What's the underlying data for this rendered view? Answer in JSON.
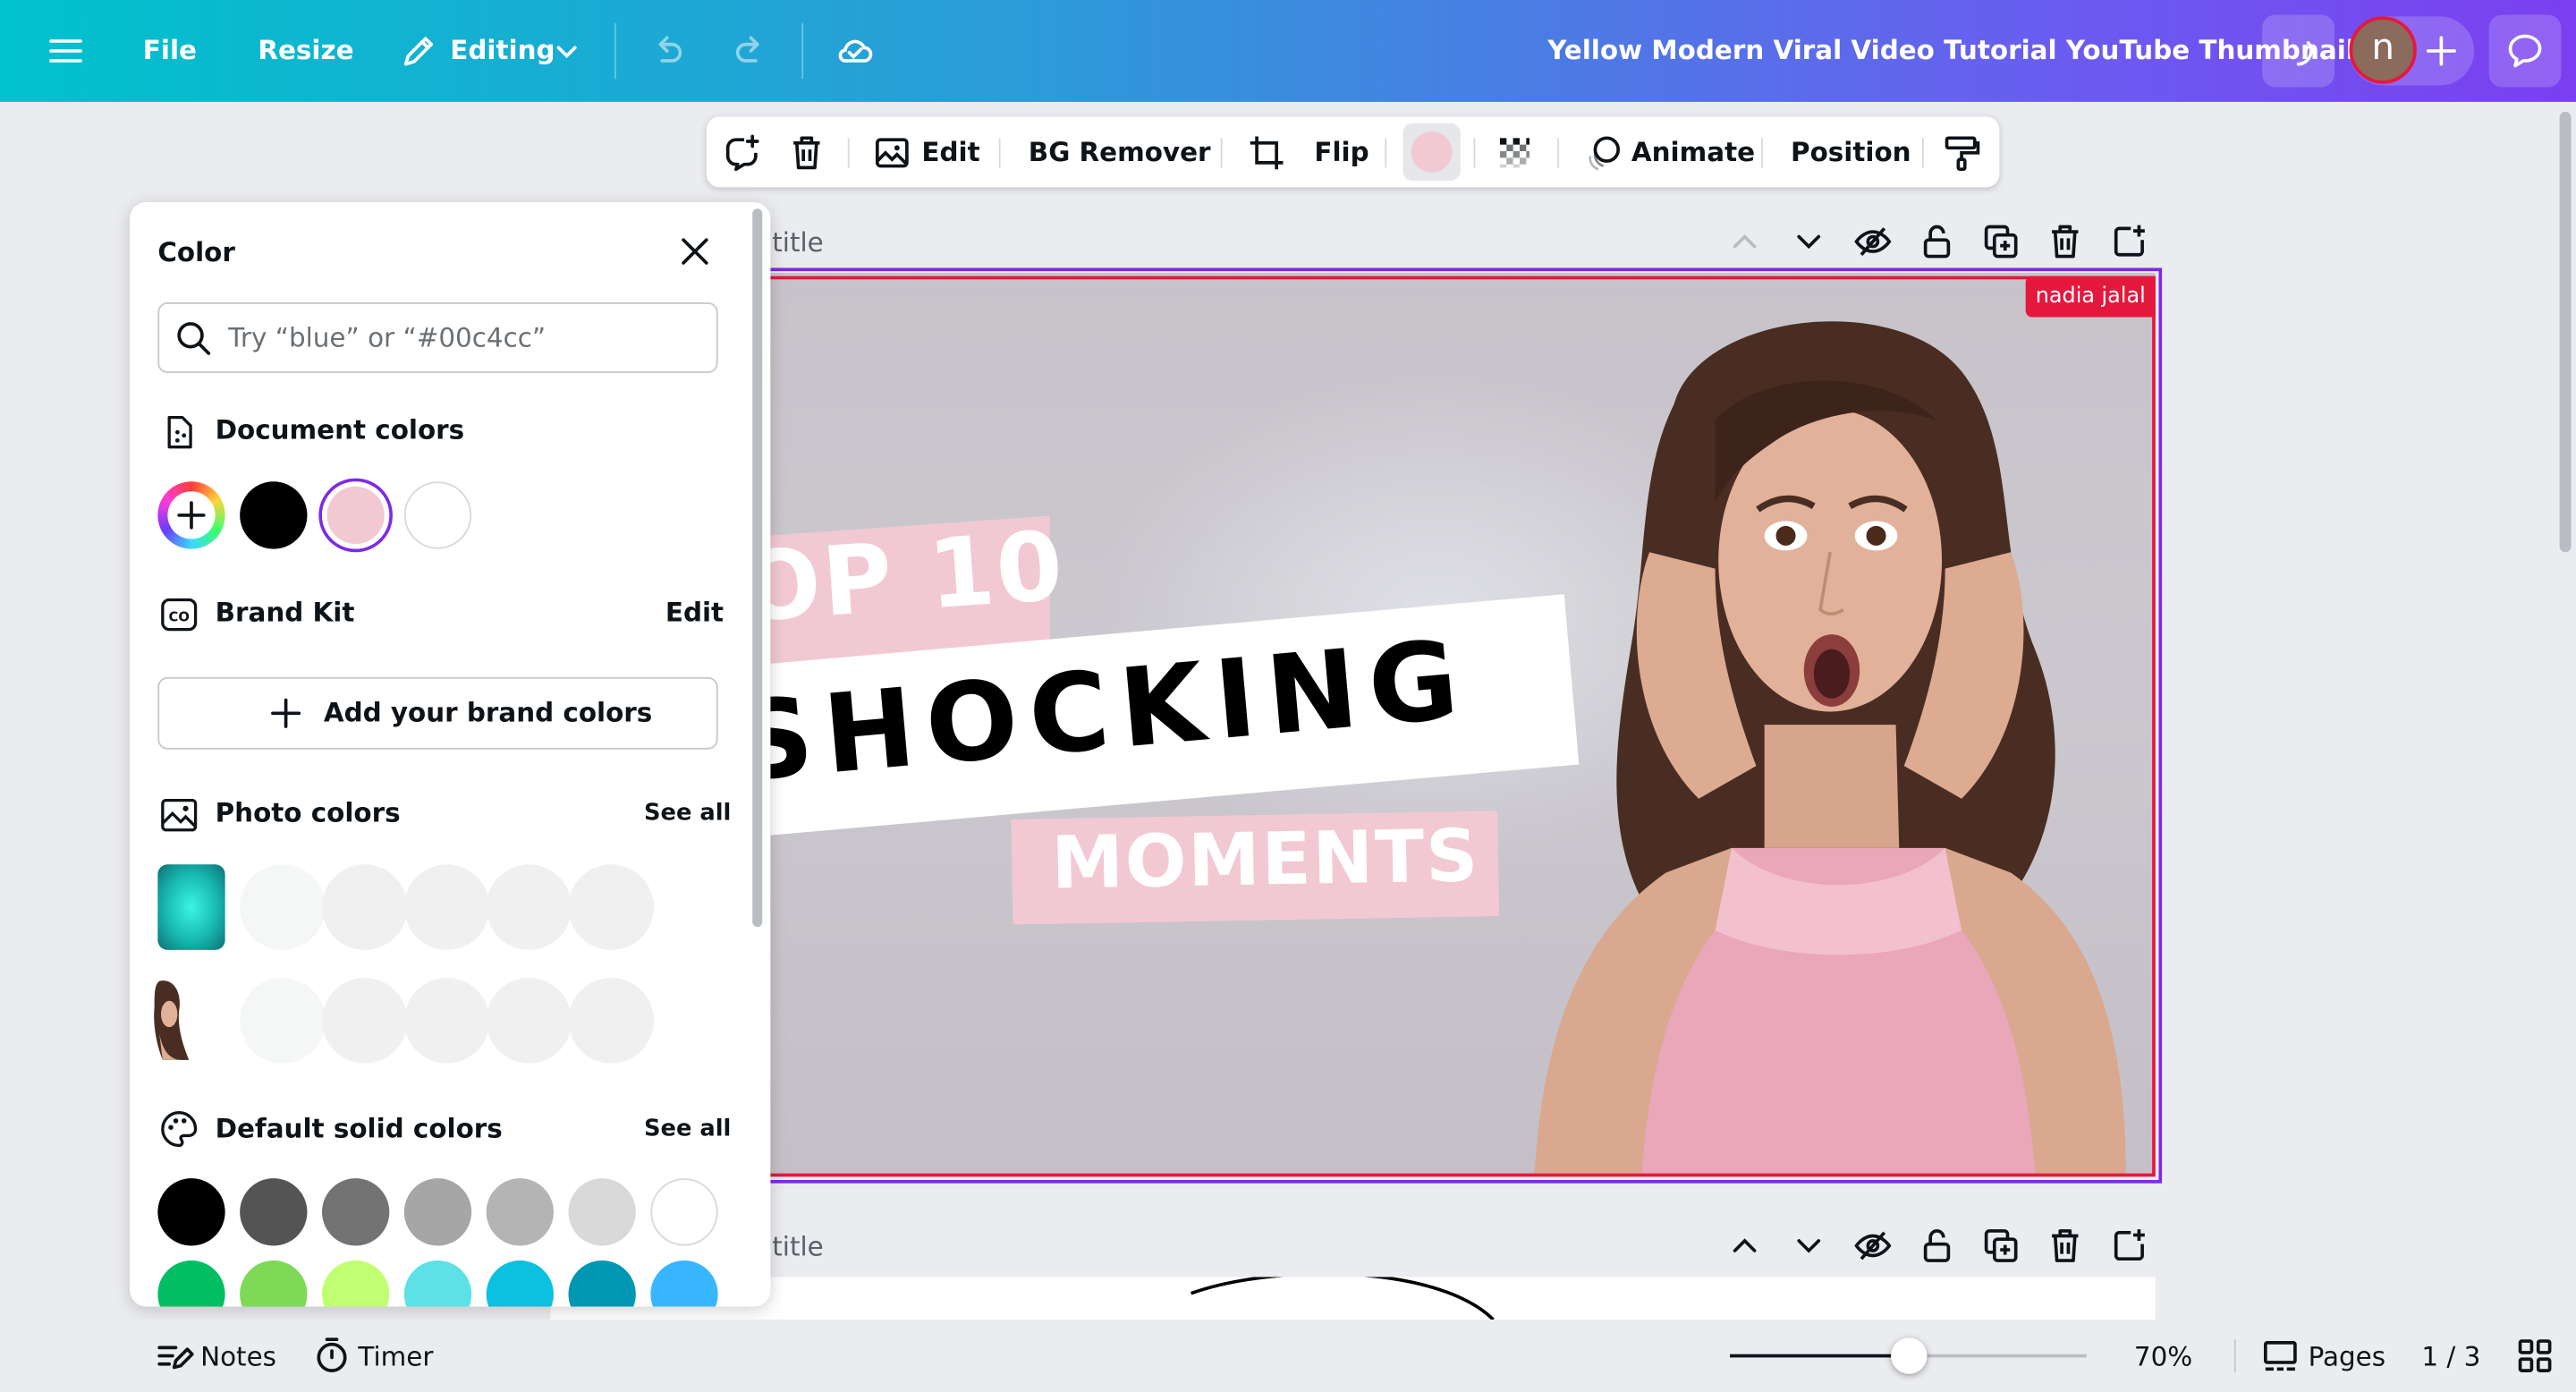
{
  "topbar": {
    "file_label": "File",
    "resize_label": "Resize",
    "editing_label": "Editing",
    "doc_title": "Yellow Modern Viral Video Tutorial YouTube Thumbnail",
    "avatar_initial": "n",
    "icons": [
      "menu-icon",
      "pencil-icon",
      "chevron-down-icon",
      "undo-icon",
      "redo-icon",
      "cloud-check-icon",
      "loading-icon",
      "plus-icon",
      "comment-icon"
    ]
  },
  "toolbar": {
    "edit_label": "Edit",
    "bg_remover_label": "BG Remover",
    "flip_label": "Flip",
    "animate_label": "Animate",
    "position_label": "Position",
    "selected_color": "#f2c9d3"
  },
  "color_panel": {
    "title": "Color",
    "search_placeholder": "Try “blue” or “#00c4cc”",
    "document_colors_label": "Document colors",
    "document_colors": [
      "#000000",
      "#f2c9d3",
      "#ffffff"
    ],
    "brand_kit_label": "Brand Kit",
    "brand_kit_edit": "Edit",
    "add_brand_colors_label": "Add your brand colors",
    "photo_colors_label": "Photo colors",
    "photo_colors_see_all": "See all",
    "default_solid_label": "Default solid colors",
    "default_solid_see_all": "See all",
    "default_colors_row1": [
      "#000000",
      "#545454",
      "#737373",
      "#a6a6a6",
      "#b4b4b4",
      "#d9d9d9",
      "#ffffff"
    ],
    "default_colors_row2": [
      "#00bf63",
      "#7ed957",
      "#c1ff72",
      "#5ce1e6",
      "#0cc0df",
      "#0097b2",
      "#38b6ff"
    ]
  },
  "canvas": {
    "page1_title": "title",
    "page2_title": "title",
    "collaborator_tag": "nadia jalal",
    "headline_top": "OP 10",
    "headline_main": "SHOCKING",
    "headline_sub": "MOMENTS",
    "accent_pink": "#f2c9d3",
    "selection_color": "#7d2ae8",
    "collaborator_color": "#e6173d"
  },
  "bottombar": {
    "notes_label": "Notes",
    "timer_label": "Timer",
    "zoom_value": "70%",
    "zoom_fraction": 0.5,
    "pages_label": "Pages",
    "page_counter": "1 / 3"
  }
}
